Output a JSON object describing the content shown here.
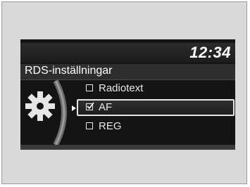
{
  "clock": {
    "time": "12:34"
  },
  "header": {
    "title": "RDS-inställningar"
  },
  "menu": {
    "items": [
      {
        "label": "Radiotext",
        "checked": false,
        "selected": false
      },
      {
        "label": "AF",
        "checked": true,
        "selected": true
      },
      {
        "label": "REG",
        "checked": false,
        "selected": false
      }
    ]
  },
  "icons": {
    "settings": "gear-icon",
    "checkbox": "checkbox-icon",
    "pointer": "selection-pointer-icon"
  }
}
